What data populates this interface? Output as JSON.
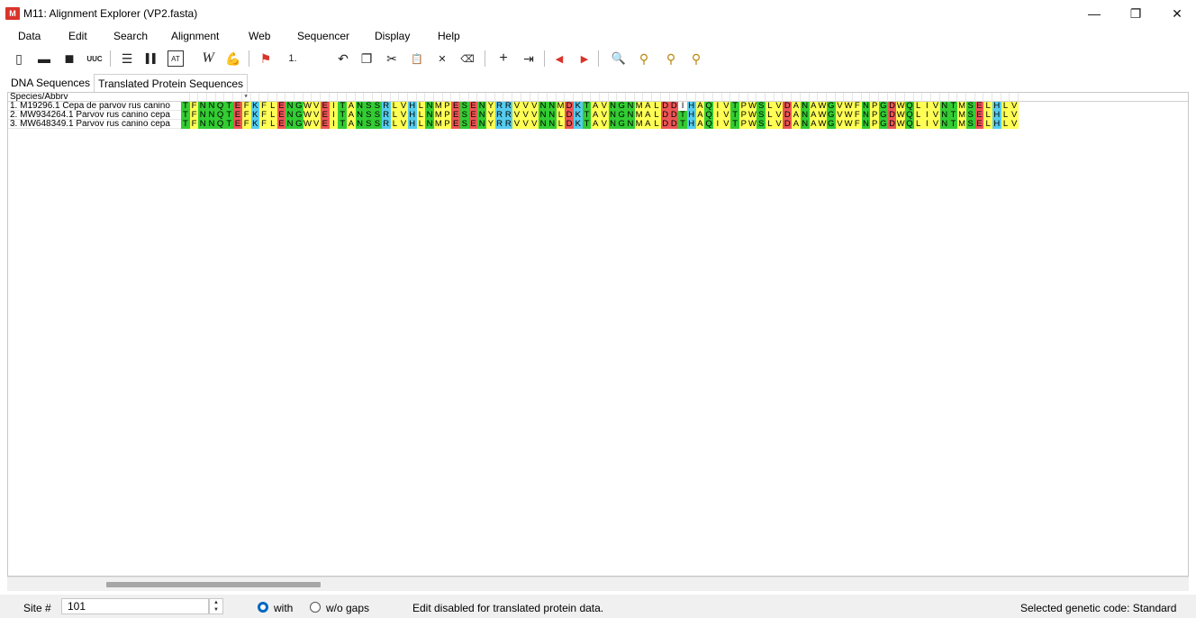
{
  "window": {
    "app_icon": "M",
    "title": "M11: Alignment Explorer (VP2.fasta)",
    "minimize_glyph": "—",
    "maximize_glyph": "❐",
    "close_glyph": "✕"
  },
  "menu": [
    "Data",
    "Edit",
    "Search",
    "Alignment",
    "Web",
    "Sequencer",
    "Display",
    "Help"
  ],
  "toolbar": {
    "icons": [
      {
        "name": "new-file-icon",
        "glyph": "▯"
      },
      {
        "name": "open-folder-icon",
        "glyph": "▬"
      },
      {
        "name": "save-icon",
        "glyph": "■"
      },
      {
        "name": "translate-icon",
        "glyph": "UUC"
      },
      {
        "name": "text-view-icon",
        "glyph": "☰"
      },
      {
        "name": "columns-icon",
        "glyph": "▌▌"
      },
      {
        "name": "dna-view-icon",
        "glyph": "AT"
      },
      {
        "name": "web-icon",
        "glyph": "W"
      },
      {
        "name": "muscle-icon",
        "glyph": "💪"
      },
      {
        "name": "mark-site-icon",
        "glyph": "⚑"
      },
      {
        "name": "site-number-icon",
        "glyph": "1."
      },
      {
        "name": "undo-icon",
        "glyph": "↶"
      },
      {
        "name": "copy-icon",
        "glyph": "❐"
      },
      {
        "name": "cut-icon",
        "glyph": "✂"
      },
      {
        "name": "paste-icon",
        "glyph": "📋"
      },
      {
        "name": "delete-icon",
        "glyph": "✕"
      },
      {
        "name": "clear-icon",
        "glyph": "⌫"
      },
      {
        "name": "add-sequence-icon",
        "glyph": "+"
      },
      {
        "name": "insert-icon",
        "glyph": "⇥"
      },
      {
        "name": "previous-icon",
        "glyph": "◀"
      },
      {
        "name": "next-icon",
        "glyph": "▶"
      },
      {
        "name": "search-icon",
        "glyph": "🔍"
      },
      {
        "name": "find-previous-icon",
        "glyph": "⚲"
      },
      {
        "name": "find-next-icon",
        "glyph": "⚲"
      },
      {
        "name": "find-marked-icon",
        "glyph": "⚲"
      }
    ]
  },
  "tabs": [
    "DNA Sequences",
    "Translated Protein Sequences"
  ],
  "grid": {
    "header_label": "Species/Abbrv",
    "consensus_mark": "*",
    "consensus_mark_column": 7,
    "rows": [
      {
        "name": "1. M19296.1 Cepa de parvov rus canino",
        "seq": "TFNNQTEFKFLENGWVEITANSSRLVHLNMPESENYRRVVVNNMDKTAVNGNMALDDIHAQIVTPWSLVDANAWGVWFNPGDWQLIVNTMSELHLV"
      },
      {
        "name": "2. MW934264.1 Parvov rus canino cepa",
        "seq": "TFNNQTEFKFLENGWVEITANSSRLVHLNMPESENYRRVVVNNLDKTAVNGNMALDDTHAQIVTPWSLVDANAWGVWFNPGDWQLIVNTMSELHLV"
      },
      {
        "name": "3. MW648349.1 Parvov rus canino cepa",
        "seq": "TFNNQTEFKFLENGWVEITANSSRLVHLNMPESENYRRVVVNNLDKTAVNGNMALDDTHAQIVTPWSLVDANAWGVWFNPGDWQLIVNTMSELHLV"
      }
    ],
    "aa_colors": {
      "T": "#33cc33",
      "N": "#33cc33",
      "Q": "#33cc33",
      "S": "#33cc33",
      "G": "#33cc33",
      "F": "#ffff55",
      "A": "#ffff55",
      "V": "#ffff55",
      "L": "#ffff55",
      "I": "#ffff55",
      "M": "#ffff55",
      "P": "#ffff55",
      "W": "#ffff55",
      "Y": "#ffff55",
      "E": "#ee5555",
      "D": "#ee5555",
      "K": "#55ccee",
      "R": "#55ccee",
      "H": "#55ccee",
      "C": "#cc66ee"
    },
    "highlight_column": 57,
    "highlight_color": "#ffffff"
  },
  "status": {
    "site_label": "Site #",
    "site_value": "101",
    "with_label": "with",
    "without_gaps_label": "w/o gaps",
    "message": "Edit disabled for translated protein data.",
    "genetic_code": "Selected genetic code: Standard"
  }
}
